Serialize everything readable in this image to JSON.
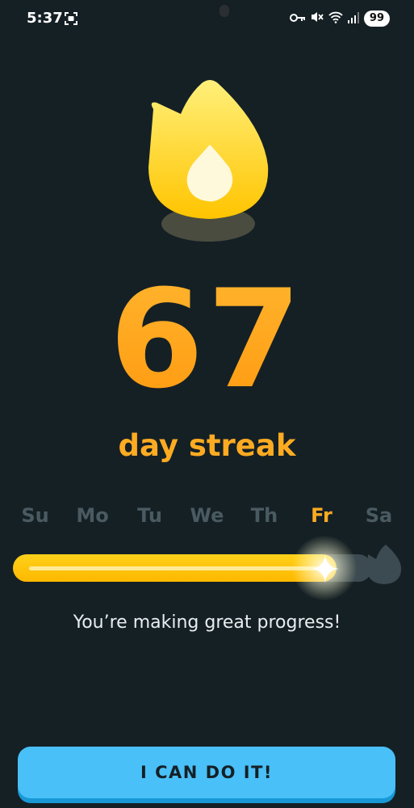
{
  "status_bar": {
    "time": "5:37",
    "battery": "99",
    "icons": [
      "screenshot-icon",
      "key-icon",
      "mute-icon",
      "wifi-icon",
      "signal-icon",
      "battery-icon"
    ]
  },
  "streak": {
    "count": "67",
    "label": "day streak",
    "icon": "flame-icon"
  },
  "week": {
    "days": [
      "Su",
      "Mo",
      "Tu",
      "We",
      "Th",
      "Fr",
      "Sa"
    ],
    "active_day": "Fr",
    "progress": 0.9
  },
  "message": "You’re making great progress!",
  "cta": {
    "label": "I CAN DO IT!"
  },
  "colors": {
    "background": "#152025",
    "streak_orange": "#ffab22",
    "progress_yellow": "#ffc800",
    "inactive_day": "#4a5a61",
    "button": "#49c0f8",
    "button_shadow": "#1899d6"
  }
}
